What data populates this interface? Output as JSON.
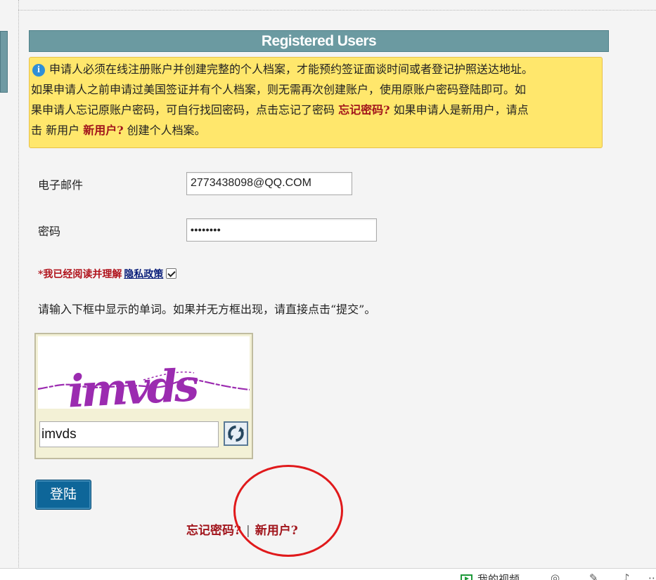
{
  "header": {
    "title": "Registered Users"
  },
  "notice": {
    "line1": "申请人必须在线注册账户并创建完整的个人档案，才能预约签证面谈时间或者登记护照送达地址。",
    "line2": "如果申请人之前申请过美国签证并有个人档案，则无需再次创建账户，使用原账户密码登陆即可。如",
    "line3_prefix": "果申请人忘记原账户密码，可自行找回密码，点击忘记了密码 ",
    "forgot_link": "忘记密码?",
    "line3_suffix": " 如果申请人是新用户，请点",
    "line4_prefix": "击 新用户 ",
    "new_user_link": "新用户?",
    "line4_suffix": " 创建个人档案。"
  },
  "form": {
    "email_label": "电子邮件",
    "email_value": "2773438098@QQ.COM",
    "password_label": "密码",
    "password_value": "••••••••",
    "agree_text": "*我已经阅读并理解",
    "privacy_link": "隐私政策",
    "agree_checked": true,
    "captcha_instruction": "请输入下框中显示的单词。如果并无方框出现，请直接点击“提交”。",
    "captcha_word": "imvds",
    "captcha_value": "imvds",
    "login_label": "登陆"
  },
  "bottom_links": {
    "forgot": "忘记密码?",
    "separator": "|",
    "new_user": "新用户?"
  },
  "taskbar": {
    "video_label": "我的视频"
  },
  "colors": {
    "header_bg": "#6b9aa1",
    "notice_bg": "#ffe76c",
    "link_red": "#a1151c",
    "login_bg": "#0e6699",
    "annotation": "#e0191b",
    "captcha_text": "#9b2bb0"
  },
  "icons": {
    "info": "info-icon",
    "refresh": "refresh-icon",
    "video": "video-icon"
  }
}
